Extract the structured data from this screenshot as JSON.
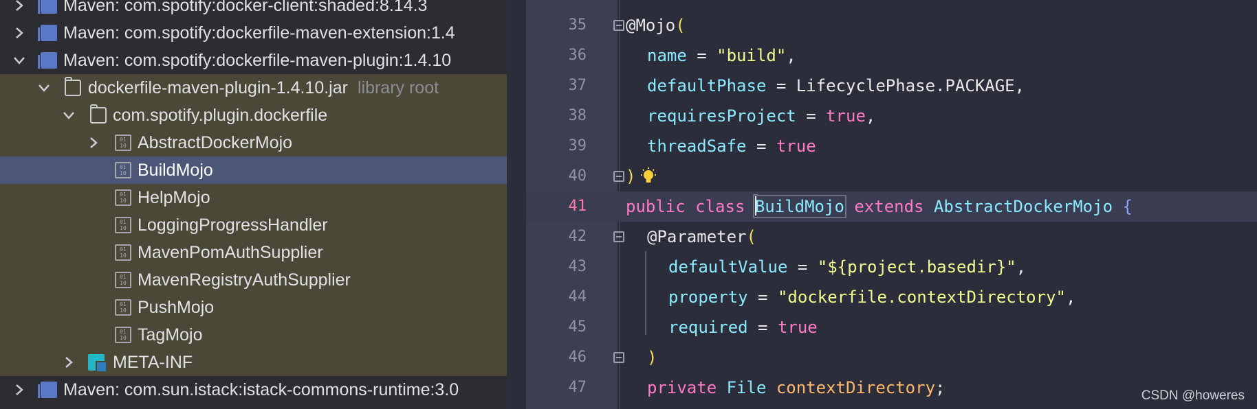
{
  "tree": {
    "rows": [
      {
        "label": "Maven: com.spotify:docker-client:shaded:8.14.3"
      },
      {
        "label": "Maven: com.spotify:dockerfile-maven-extension:1.4"
      },
      {
        "label": "Maven: com.spotify:dockerfile-maven-plugin:1.4.10"
      },
      {
        "label": "dockerfile-maven-plugin-1.4.10.jar",
        "hint": "library root"
      },
      {
        "label": "com.spotify.plugin.dockerfile"
      },
      {
        "label": "AbstractDockerMojo"
      },
      {
        "label": "BuildMojo"
      },
      {
        "label": "HelpMojo"
      },
      {
        "label": "LoggingProgressHandler"
      },
      {
        "label": "MavenPomAuthSupplier"
      },
      {
        "label": "MavenRegistryAuthSupplier"
      },
      {
        "label": "PushMojo"
      },
      {
        "label": "TagMojo"
      },
      {
        "label": "META-INF"
      },
      {
        "label": "Maven: com.sun.istack:istack-commons-runtime:3.0"
      }
    ]
  },
  "editor": {
    "line_numbers": [
      "35",
      "36",
      "37",
      "38",
      "39",
      "40",
      "41",
      "42",
      "43",
      "44",
      "45",
      "46",
      "47"
    ],
    "code": {
      "l35_ann": "@Mojo",
      "l35_paren": "(",
      "l36_attr": "name",
      "l36_eq": " = ",
      "l36_str": "\"build\"",
      "l36_end": ",",
      "l37_attr": "defaultPhase",
      "l37_eq": " = ",
      "l37_val": "LifecyclePhase.PACKAGE",
      "l37_end": ",",
      "l38_attr": "requiresProject",
      "l38_eq": " = ",
      "l38_kw": "true",
      "l38_end": ",",
      "l39_attr": "threadSafe",
      "l39_eq": " = ",
      "l39_kw": "true",
      "l40_paren": ")",
      "l41_kw1": "public class ",
      "l41_cls": "BuildMojo",
      "l41_kw2": " extends ",
      "l41_type": "AbstractDockerMojo",
      "l41_brace": " {",
      "l42_ann": "@Parameter",
      "l42_paren": "(",
      "l43_attr": "defaultValue",
      "l43_eq": " = ",
      "l43_str": "\"${project.basedir}\"",
      "l43_end": ",",
      "l44_attr": "property",
      "l44_eq": " = ",
      "l44_str": "\"dockerfile.contextDirectory\"",
      "l44_end": ",",
      "l45_attr": "required",
      "l45_eq": " = ",
      "l45_kw": "true",
      "l46_paren": ")",
      "l47_kw": "private ",
      "l47_type": "File ",
      "l47_field": "contextDirectory",
      "l47_end": ";"
    }
  },
  "watermark": "CSDN @howeres",
  "colors": {
    "selection": "#4c5677",
    "library_scope": "#4b4837",
    "keyword": "#ff79c6",
    "string": "#f1fa8c",
    "attribute": "#8be9fd",
    "current_line_number": "#ff79a8"
  },
  "icons": {
    "library": "library-icon",
    "folder": "folder-icon",
    "class_file": "class-file-icon",
    "resources_folder": "meta-inf-folder-icon",
    "intention": "lightbulb-icon"
  }
}
